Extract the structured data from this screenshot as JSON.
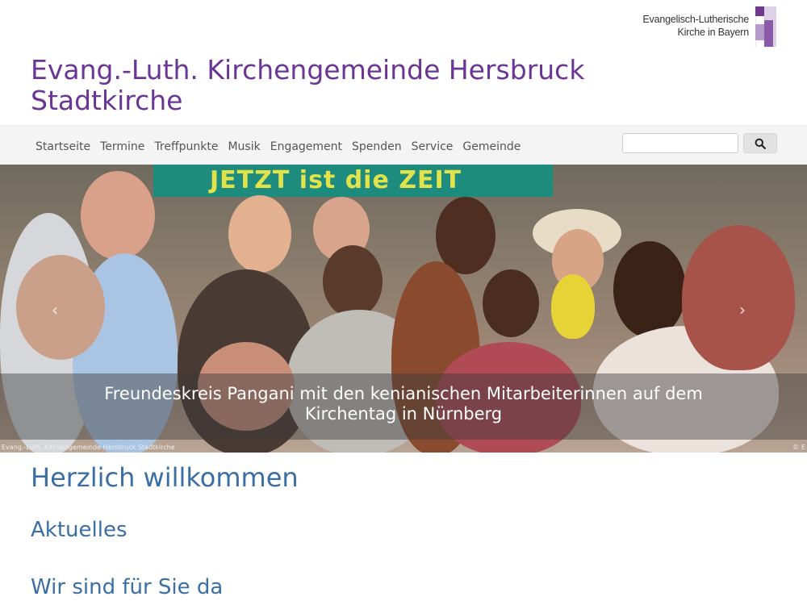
{
  "brand": {
    "line1": "Evangelisch-Lutherische",
    "line2": "Kirche in Bayern"
  },
  "site": {
    "title_line1": "Evang.-Luth. Kirchengemeinde Hersbruck",
    "title_line2": "Stadtkirche"
  },
  "nav": {
    "items": [
      "Startseite",
      "Termine",
      "Treffpunkte",
      "Musik",
      "Engagement",
      "Spenden",
      "Service",
      "Gemeinde"
    ]
  },
  "search": {
    "placeholder": "",
    "button_icon": "search-icon"
  },
  "hero": {
    "banner_text": "JETZT ist die ZEIT",
    "caption": "Freundeskreis Pangani mit den kenianischen Mitarbeiterinnen auf dem Kirchentag in Nürnberg",
    "credit_left": "Evang.-Luth. Kirchengemeinde Hersbruck Stadtkirche",
    "credit_right": "© E"
  },
  "main": {
    "heading": "Herzlich willkommen",
    "section1": "Aktuelles",
    "section2": "Wir sind für Sie da"
  },
  "colors": {
    "title_purple": "#6a3594",
    "heading_blue": "#3a6ea5"
  }
}
